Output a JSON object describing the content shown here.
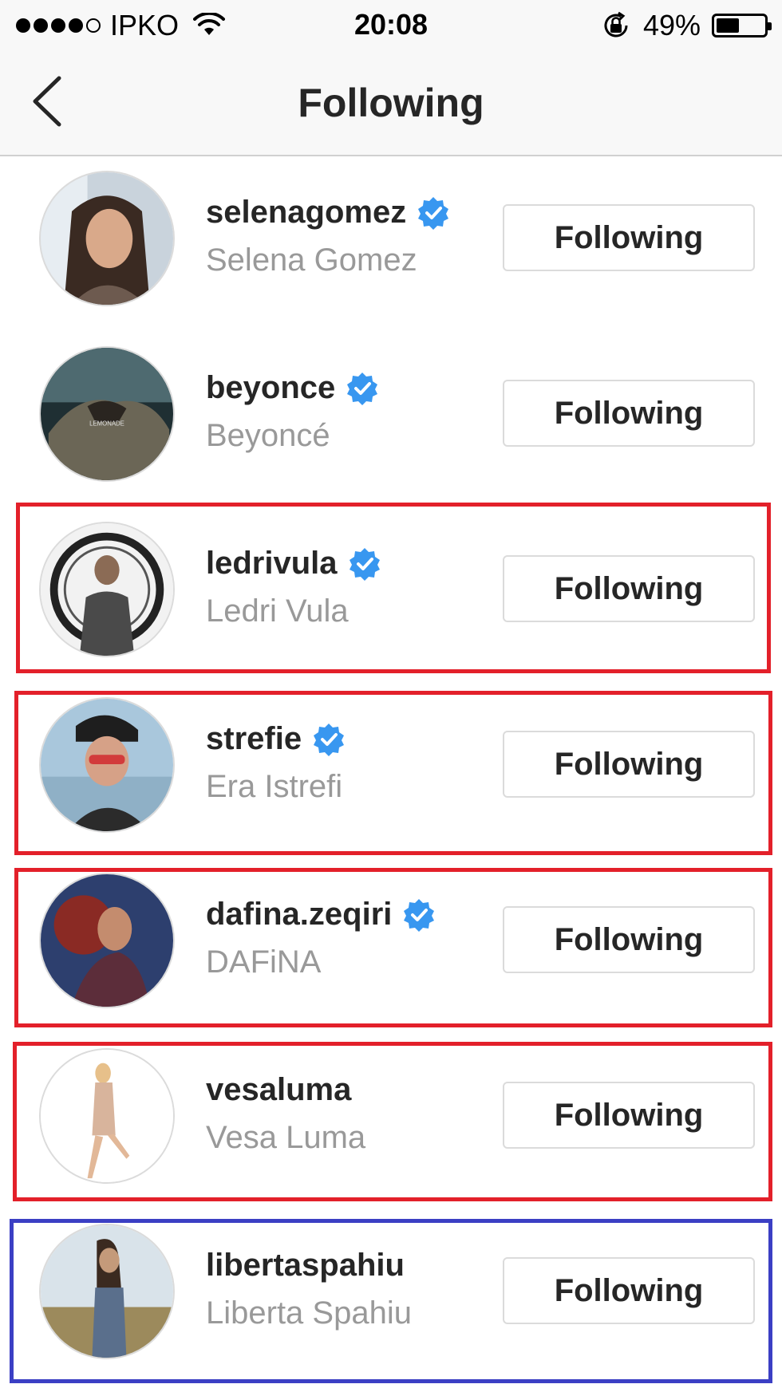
{
  "status_bar": {
    "carrier": "IPKO",
    "time": "20:08",
    "battery": "49%",
    "battery_level": 0.49,
    "signal_bars": 4,
    "signal_total": 5
  },
  "nav": {
    "title": "Following",
    "back_icon": "chevron-left-icon"
  },
  "users": [
    {
      "username": "selenagomez",
      "full_name": "Selena Gomez",
      "verified": true,
      "button": "Following"
    },
    {
      "username": "beyonce",
      "full_name": "Beyoncé",
      "verified": true,
      "button": "Following"
    },
    {
      "username": "ledrivula",
      "full_name": "Ledri Vula",
      "verified": true,
      "button": "Following"
    },
    {
      "username": "strefie",
      "full_name": "Era Istrefi",
      "verified": true,
      "button": "Following"
    },
    {
      "username": "dafina.zeqiri",
      "full_name": "DAFiNA",
      "verified": true,
      "button": "Following"
    },
    {
      "username": "vesaluma",
      "full_name": "Vesa Luma",
      "verified": false,
      "button": "Following"
    },
    {
      "username": "libertaspahiu",
      "full_name": "Liberta Spahiu",
      "verified": false,
      "button": "Following"
    }
  ],
  "colors": {
    "verified_badge": "#3897f0",
    "highlight_red": "#e3202a",
    "highlight_blue": "#3b3fc4",
    "secondary_text": "#999999"
  }
}
